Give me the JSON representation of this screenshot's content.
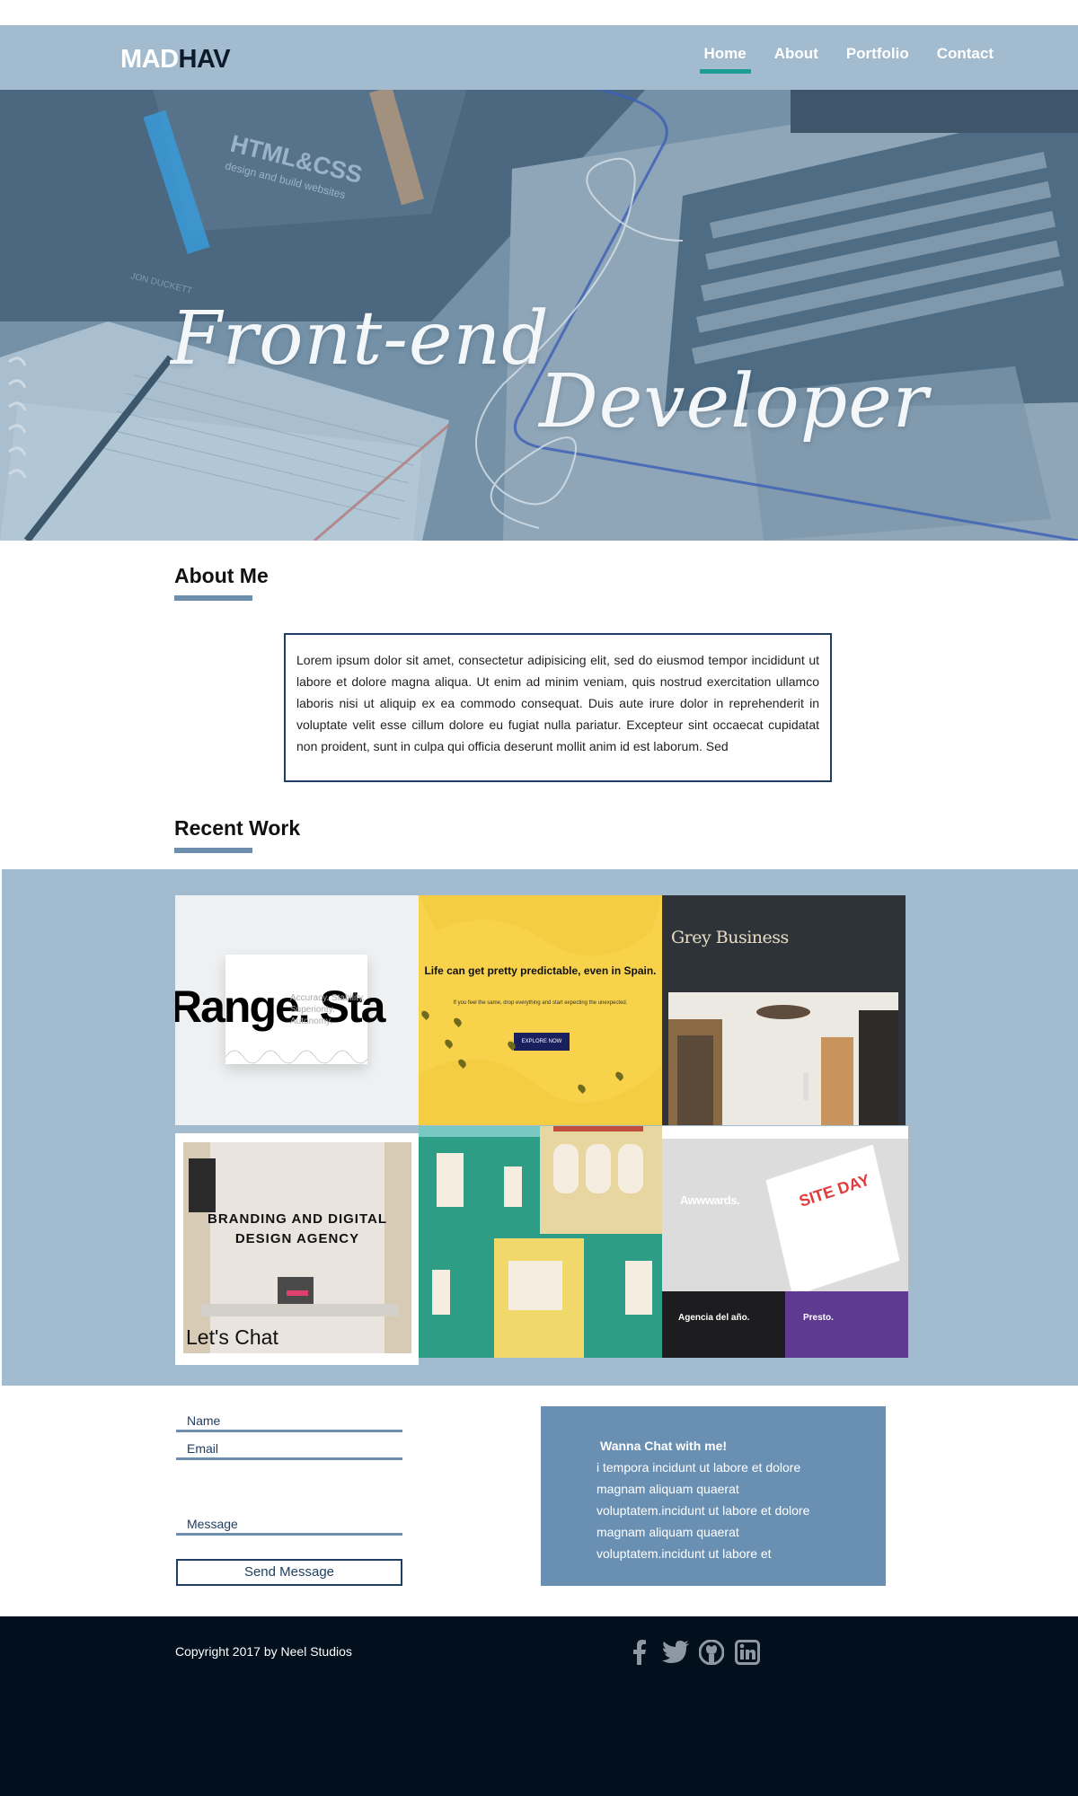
{
  "brand": {
    "logo_part1": "MAD",
    "logo_part2": "HAV"
  },
  "nav": {
    "items": [
      {
        "label": "Home",
        "active": true
      },
      {
        "label": "About",
        "active": false
      },
      {
        "label": "Portfolio",
        "active": false
      },
      {
        "label": "Contact",
        "active": false
      }
    ]
  },
  "hero": {
    "title_line1": "Front-end",
    "title_line2": "Developer",
    "book_title": "HTML&CSS",
    "book_subtitle": "design and build websites",
    "book_author": "JON DUCKETT"
  },
  "about": {
    "title": "About Me",
    "text": "Lorem ipsum dolor sit amet, consectetur adipisicing elit, sed do eiusmod tempor incididunt ut labore et dolore magna aliqua. Ut enim ad minim veniam, quis nostrud exercitation ullamco laboris nisi ut aliquip ex ea commodo consequat. Duis aute irure dolor in reprehenderit in voluptate velit esse cillum dolore eu fugiat nulla pariatur. Excepteur sint occaecat cupidatat non proident, sunt in culpa qui officia deserunt mollit anim id est laborum. Sed"
  },
  "work": {
    "title": "Recent Work",
    "tiles": [
      {
        "big_text": "Range.     Sta",
        "small_text": "Accuracy. Stability. Superiority. Autonomy."
      },
      {
        "headline": "Life can get pretty predictable, even in Spain.",
        "sub": "If you feel the same, drop everything and start expecting the unexpected.",
        "button": "EXPLORE NOW"
      },
      {
        "headline": "Grey Business"
      },
      {
        "headline": "BRANDING AND DIGITAL DESIGN AGENCY",
        "caption": "Let's Chat"
      },
      {
        "headline": ""
      },
      {
        "headline": "Awwwards.",
        "bottom_left": "Agencia del año.",
        "bottom_right": "Presto.",
        "poster": "SITE DAY"
      }
    ]
  },
  "contact": {
    "name_label": "Name",
    "email_label": "Email",
    "message_label": "Message",
    "send_label": "Send Message",
    "chat_heading": "Wanna Chat with me!",
    "chat_text": "i tempora incidunt ut labore et dolore magnam aliquam quaerat voluptatem.incidunt ut labore et dolore magnam aliquam quaerat voluptatem.incidunt ut labore et"
  },
  "footer": {
    "copyright": "Copyright 2017 by Neel Studios",
    "social": [
      "facebook-icon",
      "twitter-icon",
      "github-icon",
      "linkedin-icon"
    ]
  },
  "colors": {
    "nav_bg": "#a2bbce",
    "nav_active": "#1b9e94",
    "accent": "#6d8fad",
    "border_dark": "#1f3f62",
    "footer_bg": "#020f1c"
  }
}
